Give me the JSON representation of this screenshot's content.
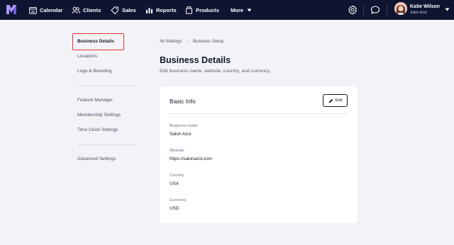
{
  "nav": {
    "items": [
      {
        "label": "Calendar"
      },
      {
        "label": "Clients"
      },
      {
        "label": "Sales"
      },
      {
        "label": "Reports"
      },
      {
        "label": "Products"
      },
      {
        "label": "More"
      }
    ],
    "user": {
      "name": "Katie Wilson",
      "subtitle": "Salon Azul"
    }
  },
  "sidebar": {
    "groups": [
      {
        "items": [
          {
            "label": "Business Details",
            "active": true
          },
          {
            "label": "Locations"
          },
          {
            "label": "Logo & Branding"
          }
        ]
      },
      {
        "items": [
          {
            "label": "Feature Manager"
          },
          {
            "label": "Membership Settings"
          },
          {
            "label": "Time Clock Settings"
          }
        ]
      },
      {
        "items": [
          {
            "label": "Advanced Settings"
          }
        ]
      }
    ]
  },
  "breadcrumb": [
    "All Settings",
    "Business Setup"
  ],
  "page": {
    "title": "Business Details",
    "subtitle": "Edit business name, website, country, and currency."
  },
  "card": {
    "title": "Basic Info",
    "edit_label": "Edit",
    "fields": [
      {
        "label": "Business name",
        "value": "Salon Azul"
      },
      {
        "label": "Website",
        "value": "https://salonazul.com"
      },
      {
        "label": "Country",
        "value": "USA"
      },
      {
        "label": "Currency",
        "value": "USD"
      }
    ]
  },
  "colors": {
    "navbar": "#0f1430",
    "background": "#f2f2f7",
    "highlight": "#e8322f"
  }
}
